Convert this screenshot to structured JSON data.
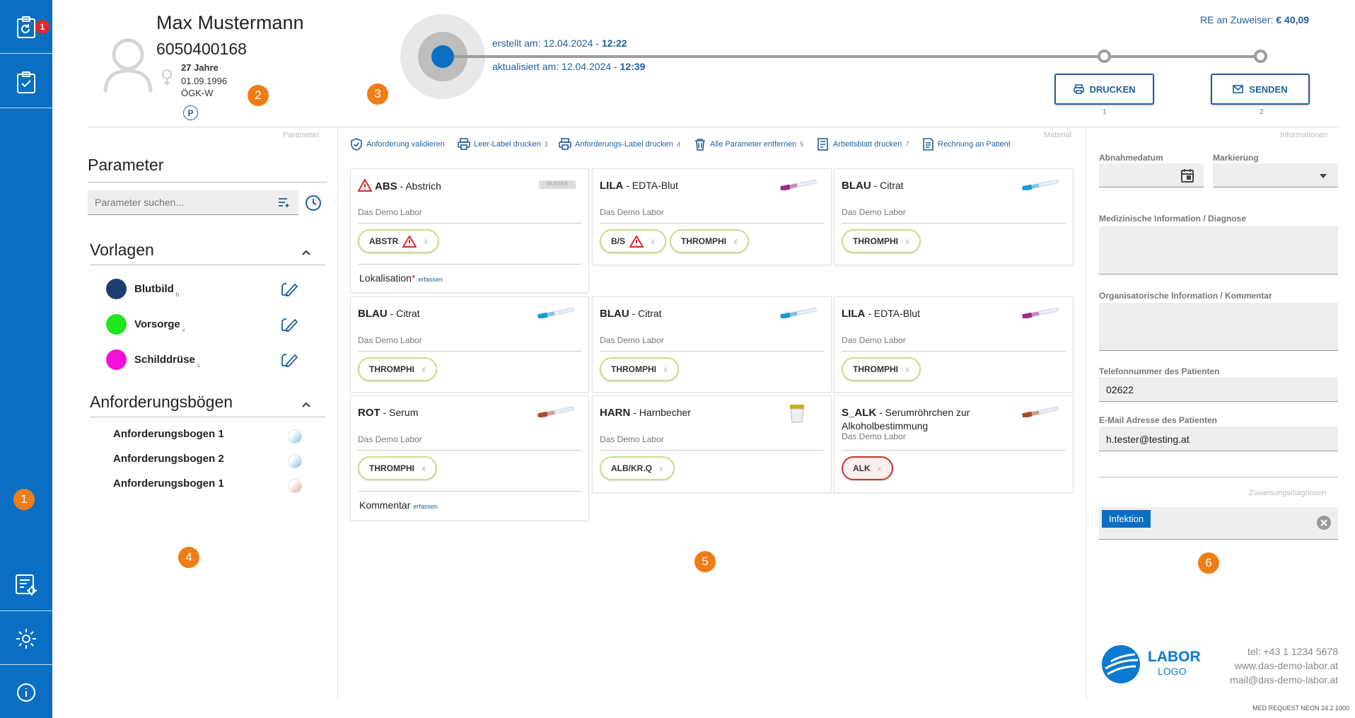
{
  "sidebar": {
    "badge_count": "1",
    "step_number": "1",
    "icons": [
      "clipboard-refresh-icon",
      "clipboard-check-icon",
      "settings-document-icon",
      "gear-icon",
      "info-icon"
    ]
  },
  "patient": {
    "name": "Max Mustermann",
    "id": "6050400168",
    "age": "27 Jahre",
    "birthdate": "01.09.1996",
    "insurance": "ÖGK-W",
    "private_badge": "P"
  },
  "step_numbers": {
    "patient": "2",
    "timeline": "3",
    "left_panel": "4",
    "main": "5",
    "right_panel": "6"
  },
  "timeline": {
    "created_label": "erstellt am: 12.04.2024 - ",
    "created_time": "12:22",
    "updated_label": "aktualisiert am: 12.04.2024 - ",
    "updated_time": "12:39",
    "referrer_label": "RE an Zuweiser:",
    "referrer_amount": "€  40,09",
    "print_label": "DRUCKEN",
    "print_step": "1",
    "send_label": "SENDEN",
    "send_step": "2"
  },
  "section_labels": {
    "parameter": "Parameter",
    "material": "Material",
    "info": "Informationen"
  },
  "left_panel": {
    "title": "Parameter",
    "search_placeholder": "Parameter suchen...",
    "templates_title": "Vorlagen",
    "templates": [
      {
        "name": "Blutbild",
        "key": "b",
        "color": "#1d3f6e"
      },
      {
        "name": "Vorsorge",
        "key": "v",
        "color": "#22e61f"
      },
      {
        "name": "Schilddrüse",
        "key": "s",
        "color": "#f20fd8"
      }
    ],
    "forms_title": "Anforderungsbögen",
    "forms": [
      "Anforderungsbogen 1",
      "Anforderungsbogen 2",
      "Anforderungsbogen 1"
    ]
  },
  "toolbar": [
    {
      "label": "Anforderung validieren",
      "key": "",
      "icon": "shield-check-icon"
    },
    {
      "label": "Leer-Label drucken",
      "key": "3",
      "icon": "printer-icon"
    },
    {
      "label": "Anforderungs-Label drucken",
      "key": "4",
      "icon": "printer-icon"
    },
    {
      "label": "Alle Parameter entfernen",
      "key": "5",
      "icon": "trash-icon"
    },
    {
      "label": "Arbeitsblatt drucken",
      "key": "7",
      "icon": "worksheet-icon"
    },
    {
      "label": "Rechnung an Patient",
      "key": "",
      "icon": "invoice-icon"
    }
  ],
  "cards": [
    {
      "code": "ABS",
      "name": "Abstrich",
      "lab": "Das Demo Labor",
      "chips": [
        "ABSTR"
      ],
      "footer": "Lokalisation",
      "footer_link": "erfassen",
      "tube": "muster",
      "muster": "MUSTER"
    },
    {
      "code": "LILA",
      "name": "EDTA-Blut",
      "lab": "Das Demo Labor",
      "chips": [
        "B/S",
        "THROMPHI"
      ],
      "tube": "lila"
    },
    {
      "code": "BLAU",
      "name": "Citrat",
      "lab": "Das Demo Labor",
      "chips": [
        "THROMPHI"
      ],
      "tube": "blau"
    },
    {
      "code": "BLAU",
      "name": "Citrat",
      "lab": "Das Demo Labor",
      "chips": [
        "THROMPHI"
      ],
      "tube": "blau"
    },
    {
      "code": "BLAU",
      "name": "Citrat",
      "lab": "Das Demo Labor",
      "chips": [
        "THROMPHI"
      ],
      "tube": "blau"
    },
    {
      "code": "LILA",
      "name": "EDTA-Blut",
      "lab": "Das Demo Labor",
      "chips": [
        "THROMPHI"
      ],
      "tube": "lila"
    },
    {
      "code": "ROT",
      "name": "Serum",
      "lab": "Das Demo Labor",
      "chips": [
        "THROMPHI"
      ],
      "footer": "Kommentar",
      "footer_link": "erfassen",
      "tube": "rot"
    },
    {
      "code": "HARN",
      "name": "Harnbecher",
      "lab": "Das Demo Labor",
      "chips": [
        "ALB/KR.Q"
      ],
      "tube": "harn"
    },
    {
      "code": "S_ALK",
      "name": "Serumröhrchen zur Alkoholbestimmung",
      "lab": "Das Demo Labor",
      "chips": [
        "ALK"
      ],
      "tube": "rot"
    }
  ],
  "chip_remove": "x",
  "right_panel": {
    "abnahme_label": "Abnahmedatum",
    "markierung_label": "Markierung",
    "med_label": "Medizinische Information / Diagnose",
    "org_label": "Organisatorische Information / Kommentar",
    "phone_label": "Telefonnummer des Patienten",
    "phone_value": "02622",
    "email_label": "E-Mail Adresse des Patienten",
    "email_value": "h.tester@testing.at",
    "diag_title": "Zuweisungsdiagnosen",
    "diag_tag": "Infektion",
    "logo_top": "LABOR",
    "logo_bottom": "LOGO",
    "contact_tel": "tel: +43 1 1234 5678",
    "contact_web": "www.das-demo-labor.at",
    "contact_mail": "mail@das-demo-labor.at",
    "version": "MED REQUEST NEON 24.2.1000"
  }
}
